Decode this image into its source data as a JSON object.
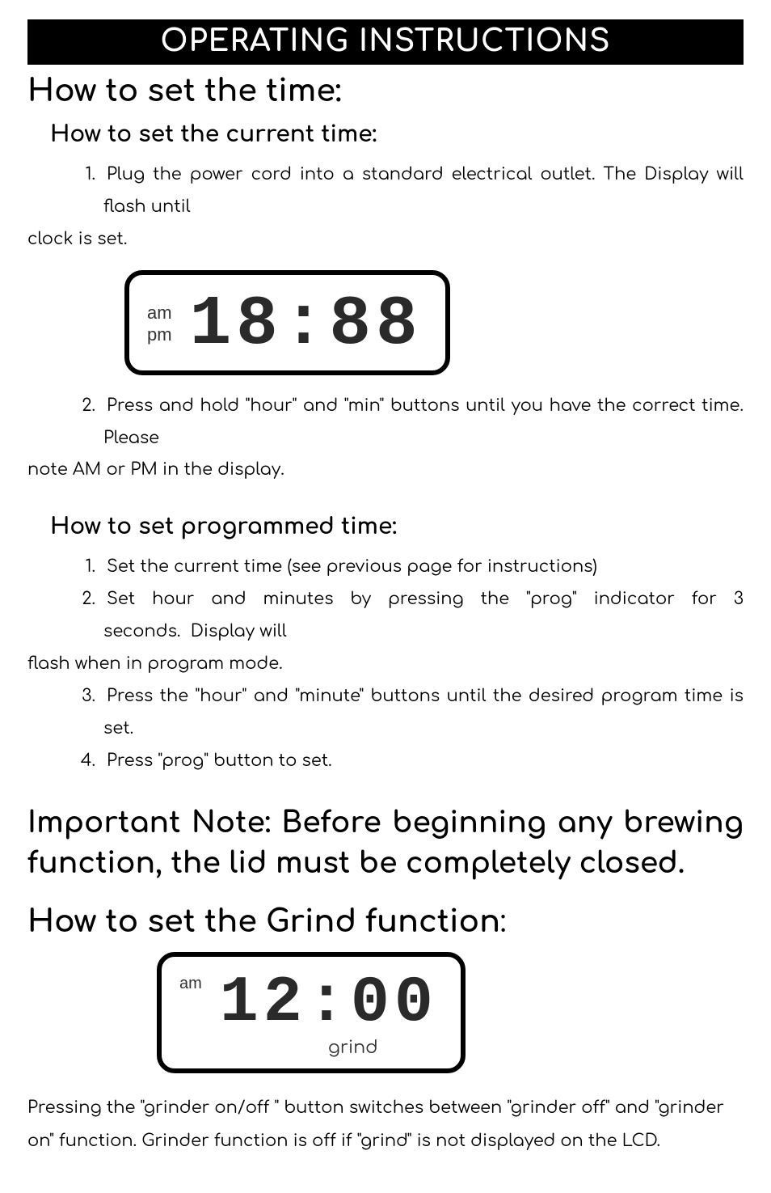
{
  "banner": "OPERATING INSTRUCTIONS",
  "section1": {
    "heading": "How to set the time:",
    "sub1": {
      "heading": "How to set the current time:",
      "steps": [
        {
          "num": "1.",
          "text": "Plug the power cord into a standard electrical outlet. The Display will flash until clock is set."
        },
        {
          "num": "2.",
          "text": "Press and hold \"hour\" and \"min\" buttons until you have the correct time. Please note AM or PM in the display."
        }
      ]
    },
    "display1": {
      "am": "am",
      "pm": "pm",
      "digits": "18:88"
    },
    "sub2": {
      "heading": "How to set programmed time:",
      "steps": [
        {
          "num": "1.",
          "text": "Set the current time (see previous page for instructions)"
        },
        {
          "num": "2.",
          "text": "Set hour and minutes by pressing the \"prog\" indicator for 3 seconds.  Display will flash when in program mode."
        },
        {
          "num": "3.",
          "text": "Press the \"hour\" and \"minute\" buttons until the desired program time is set."
        },
        {
          "num": "4.",
          "text": "Press \"prog\" button to set."
        }
      ]
    }
  },
  "important_note": "Important Note: Before beginning any brewing function, the lid must be completely closed.",
  "section2": {
    "heading": "How to set the Grind function",
    "colon": ":",
    "display2": {
      "am": "am",
      "digits": "12:00",
      "grind": "grind"
    },
    "footer": "Pressing the \"grinder on/off \" button switches between \"grinder off\" and \"grinder on\" function. Grinder function is off if \"grind\" is not displayed on the LCD."
  }
}
